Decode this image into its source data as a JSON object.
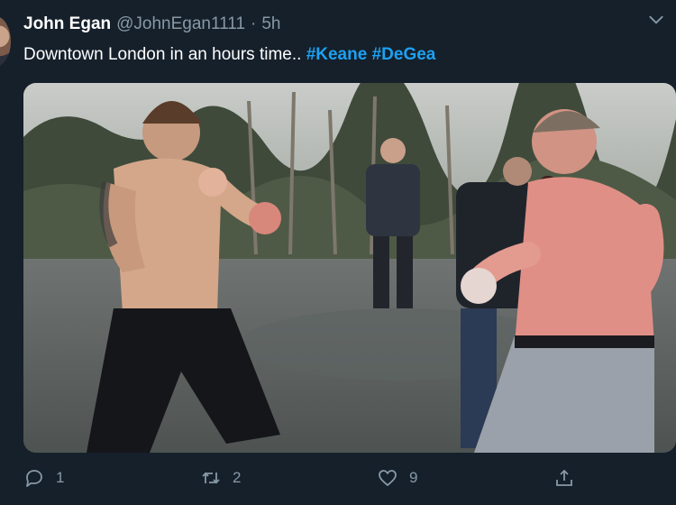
{
  "tweet": {
    "author_name": "John Egan",
    "handle": "@JohnEgan1111",
    "separator": "·",
    "time": "5h",
    "text": "Downtown London in an hours time..",
    "hashtags": [
      "#Keane",
      "#DeGea"
    ]
  },
  "actions": {
    "reply_count": "1",
    "retweet_count": "2",
    "like_count": "9",
    "reply_icon": "reply-icon",
    "retweet_icon": "retweet-icon",
    "like_icon": "heart-icon",
    "share_icon": "share-icon"
  },
  "colors": {
    "background": "#15202b",
    "secondary_text": "#8899a6",
    "link": "#1da1f2"
  }
}
